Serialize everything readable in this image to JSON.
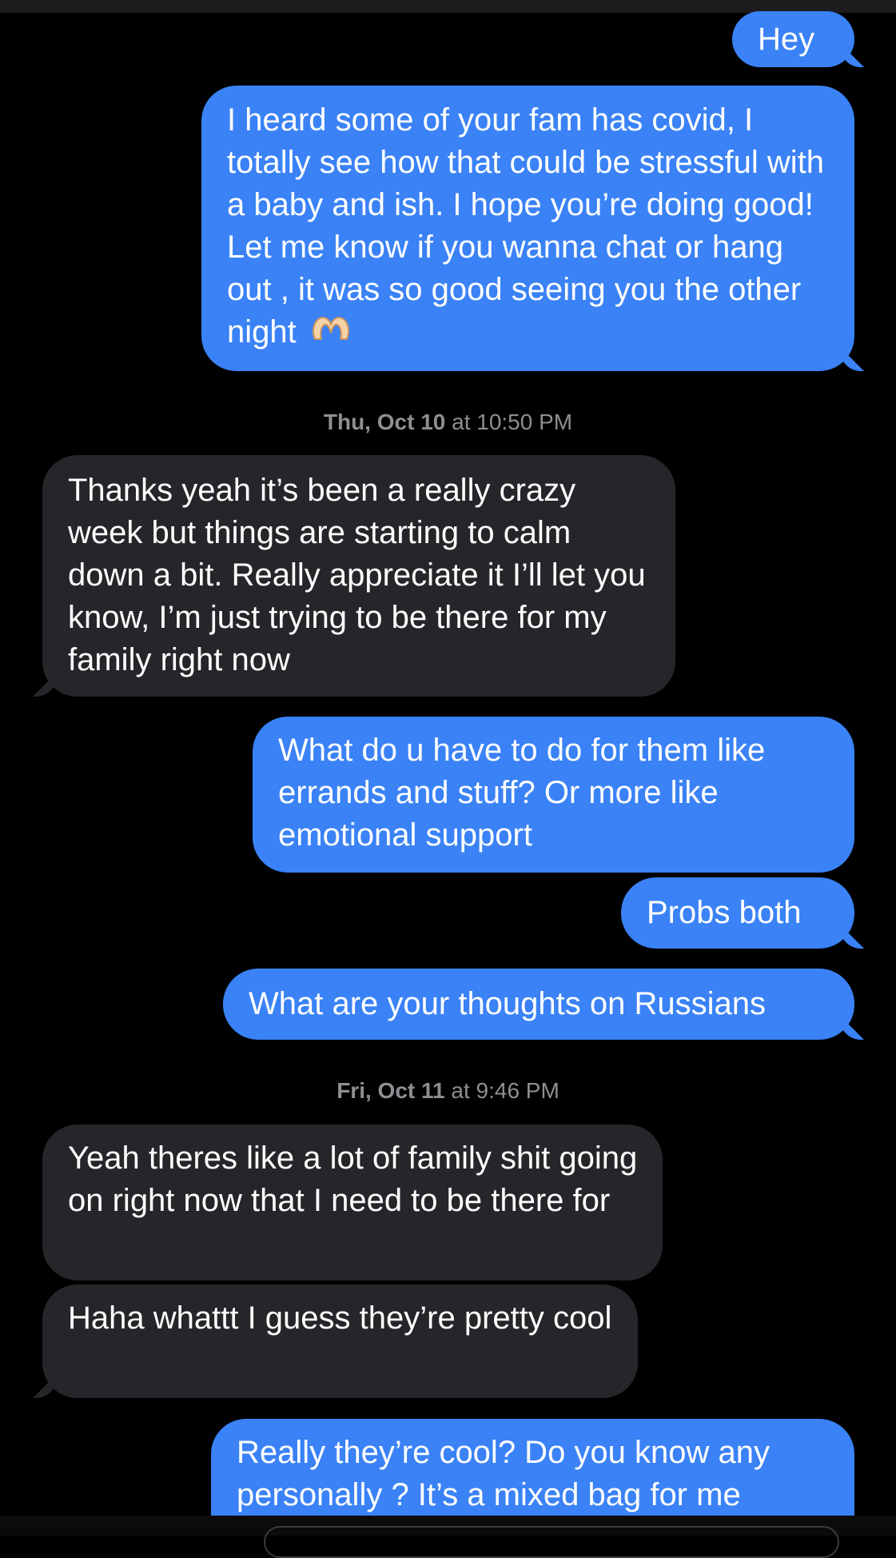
{
  "thread": {
    "messages": [
      {
        "id": "m1",
        "kind": "sent",
        "text": "Hey"
      },
      {
        "id": "m2",
        "kind": "sent",
        "text": "I heard some of your fam has covid, I totally see how that could be stressful with a baby and ish. I hope you’re doing good! Let me know if you wanna chat or hang out , it was so good seeing you the other night"
      },
      {
        "id": "m3",
        "kind": "recv",
        "text": "Thanks yeah it’s been a really crazy week but things are starting to calm down a bit. Really appreciate it I’ll let you know, I’m just trying to be there for my family right now"
      },
      {
        "id": "m4",
        "kind": "sent",
        "text": "What do u have to do for them like errands and stuff? Or more like emotional support"
      },
      {
        "id": "m5",
        "kind": "sent",
        "text": "Probs both"
      },
      {
        "id": "m6",
        "kind": "sent",
        "text": "What are your thoughts on Russians"
      },
      {
        "id": "m7",
        "kind": "recv",
        "text": "Yeah theres like a lot of family shit going on right now that I need to be there for"
      },
      {
        "id": "m8",
        "kind": "recv",
        "text": "Haha whattt I guess they’re pretty cool"
      },
      {
        "id": "m9",
        "kind": "sent",
        "text": "Really they’re cool? Do you know any personally ? It’s a mixed bag for me"
      }
    ],
    "timestamps": [
      {
        "day": "Thu, Oct 10",
        "time": "at 10:50 PM"
      },
      {
        "day": "Fri, Oct 11",
        "time": "at 9:46 PM"
      }
    ]
  },
  "emoji": {
    "m2": "heart-hands-emoji"
  },
  "colors": {
    "sent_bubble": "#3a82f6",
    "received_bubble": "#26262a",
    "background": "#000000",
    "timestamp": "#8e8e93"
  }
}
